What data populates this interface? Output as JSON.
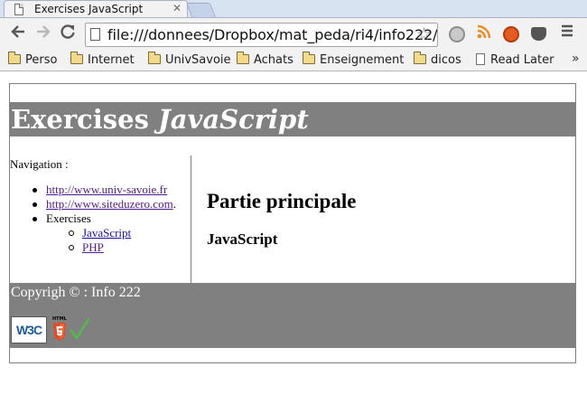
{
  "browser": {
    "tab": {
      "title": "Exercises JavaScript",
      "close_glyph": "✕"
    },
    "url": "file:///donnees/Dropbox/mat_peda/ri4/info222/",
    "bookmarks": [
      {
        "label": "Perso",
        "icon": "folder-icon"
      },
      {
        "label": "Internet",
        "icon": "folder-icon"
      },
      {
        "label": "UnivSavoie",
        "icon": "folder-icon"
      },
      {
        "label": "Achats",
        "icon": "folder-icon"
      },
      {
        "label": "Enseignement",
        "icon": "folder-icon"
      },
      {
        "label": "dicos",
        "icon": "folder-icon"
      },
      {
        "label": "Read Later",
        "icon": "page-icon"
      }
    ],
    "bookmarks_overflow": "»",
    "extension_icons": [
      "adblock-icon",
      "rss-icon",
      "fire-icon",
      "pocket-icon"
    ]
  },
  "page": {
    "header": {
      "title_plain": "Exercises ",
      "title_italic": "JavaScript"
    },
    "nav": {
      "title": "Navigation :",
      "items": [
        {
          "label": "http://www.univ-savoie.fr",
          "suffix": ""
        },
        {
          "label": "http://www.siteduzero.com",
          "suffix": "."
        },
        {
          "label": "Exercises",
          "suffix": ""
        }
      ],
      "subitems": [
        "JavaScript",
        "PHP"
      ]
    },
    "main": {
      "heading": "Partie principale",
      "subheading": "JavaScript"
    },
    "footer": {
      "copyright": "Copyrigh © : Info 222",
      "badges": {
        "w3c": "W3C",
        "html5": "HTML"
      }
    }
  },
  "colors": {
    "banner_grey": "#808080",
    "link_visited": "#551a8b",
    "link_unvisited": "#1a0dab",
    "chrome_toolbar": "#f2f2f2"
  }
}
